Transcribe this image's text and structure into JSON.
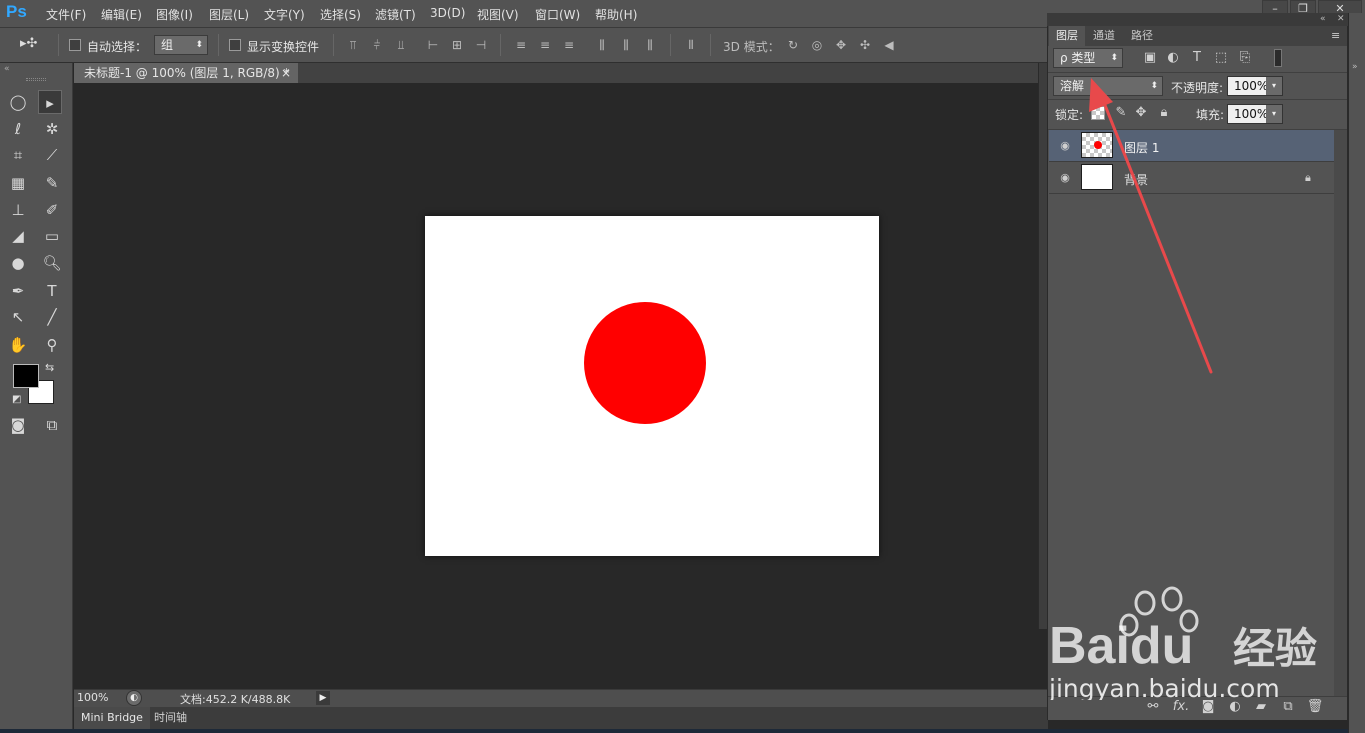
{
  "app": {
    "logo": "Ps"
  },
  "menu": [
    "文件(F)",
    "编辑(E)",
    "图像(I)",
    "图层(L)",
    "文字(Y)",
    "选择(S)",
    "滤镜(T)",
    "3D(D)",
    "视图(V)",
    "窗口(W)",
    "帮助(H)"
  ],
  "window_controls": {
    "minimize": "–",
    "maximize": "❐",
    "close": "✕"
  },
  "options": {
    "auto_select_label": "自动选择：",
    "auto_select_value": "组",
    "show_transform_label": "显示变换控件",
    "mode_3d_label": "3D 模式："
  },
  "document": {
    "tab_title": "未标题-1 @ 100% (图层 1, RGB/8) *",
    "tab_close": "×",
    "circle_color": "#ff0000"
  },
  "status": {
    "zoom": "100%",
    "doc_info": "文档:452.2 K/488.8K"
  },
  "bottom_tabs": [
    "Mini Bridge",
    "时间轴"
  ],
  "layers_panel": {
    "tabs": [
      "图层",
      "通道",
      "路径"
    ],
    "filter_kind": "ρ 类型",
    "blend_mode": "溶解",
    "opacity_label": "不透明度:",
    "opacity_value": "100%",
    "lock_label": "锁定:",
    "fill_label": "填充:",
    "fill_value": "100%",
    "layers": [
      {
        "name": "图层 1",
        "selected": true
      },
      {
        "name": "背景",
        "selected": false,
        "locked": true
      }
    ],
    "bottom_icons": [
      "link-icon",
      "fx-icon",
      "mask-icon",
      "adjustment-icon",
      "folder-icon",
      "new-layer-icon",
      "trash-icon"
    ],
    "bottom_fx": "fx."
  },
  "annotation": {
    "arrow_color": "#e8494b"
  },
  "watermark": {
    "brand": "Baidu",
    "brand_cn": "经验",
    "url": "jingyan.baidu.com"
  }
}
